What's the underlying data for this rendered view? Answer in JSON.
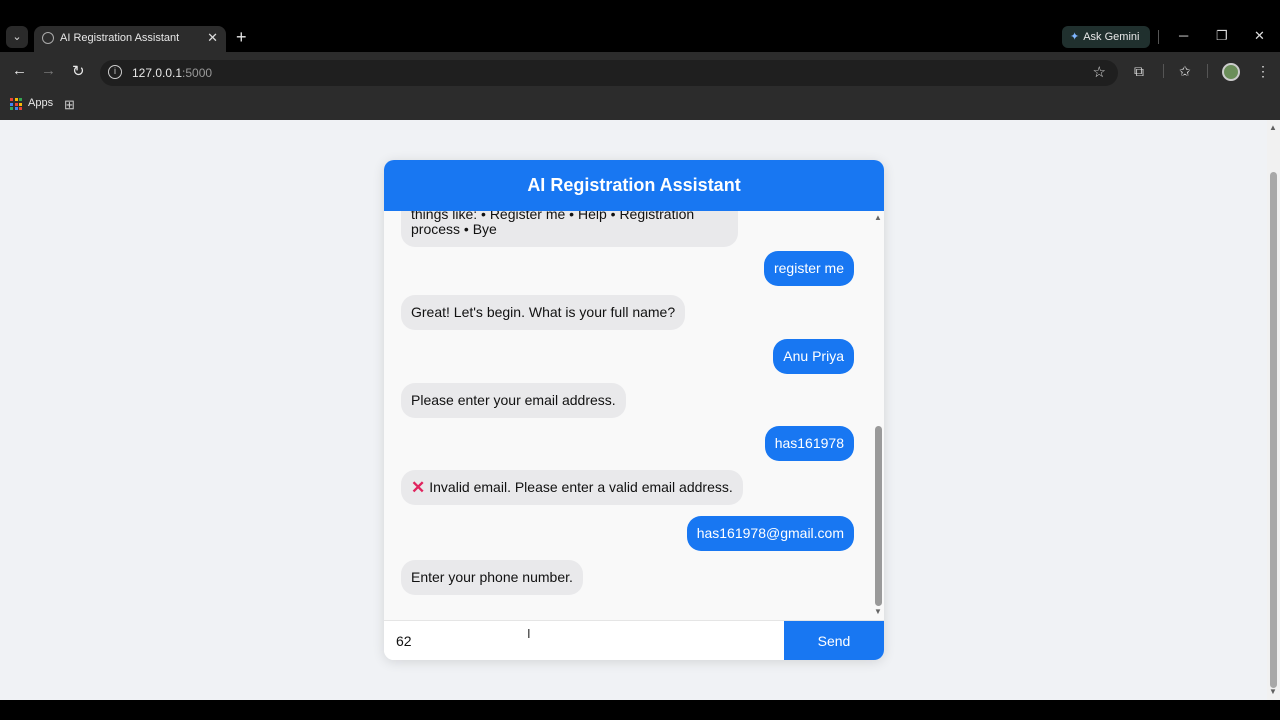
{
  "browser": {
    "tab_title": "AI Registration Assistant",
    "tab_close": "✕",
    "new_tab": "+",
    "ask_gemini": "Ask Gemini",
    "url_host": "127.0.0.1",
    "url_port": ":5000",
    "bookmarks": {
      "apps_label": "Apps"
    },
    "window_controls": {
      "minimize": "─",
      "restore": "❐",
      "close": "✕"
    }
  },
  "chat": {
    "title": "AI Registration Assistant",
    "messages": [
      {
        "role": "bot",
        "text": "things like: • Register me • Help • Registration process • Bye"
      },
      {
        "role": "user",
        "text": "register me"
      },
      {
        "role": "bot",
        "text": "Great! Let's begin. What is your full name?"
      },
      {
        "role": "user",
        "text": "Anu Priya"
      },
      {
        "role": "bot",
        "text": "Please enter your email address."
      },
      {
        "role": "user",
        "text": "has161978"
      },
      {
        "role": "bot",
        "icon": "cross-mark-icon",
        "icon_color": "#e0245e",
        "text": "Invalid email. Please enter a valid email address."
      },
      {
        "role": "user",
        "text": "has161978@gmail.com"
      },
      {
        "role": "bot",
        "text": "Enter your phone number."
      }
    ],
    "input_value": "62",
    "send_label": "Send"
  },
  "colors": {
    "accent": "#1877f2",
    "bot_bubble": "#e9e9eb",
    "page_bg": "#f0f2f5"
  }
}
